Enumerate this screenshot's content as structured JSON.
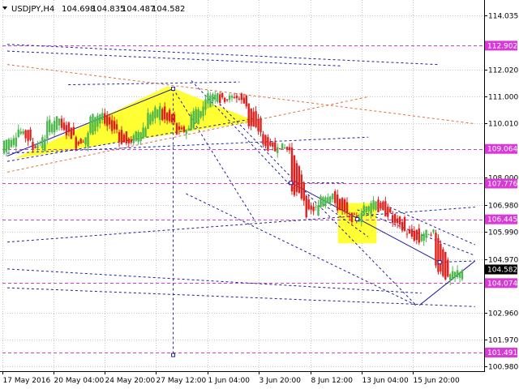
{
  "header": {
    "symbol_timeframe": "USDJPY,H4",
    "open": "104.698",
    "high": "104.835",
    "low": "104.487",
    "close": "104.582"
  },
  "colors": {
    "background": "#ffffff",
    "grid": "#c8c8c8",
    "axis": "#000000",
    "bull": "#4db84d",
    "bear": "#e0201c",
    "blue_line": "#2020a0",
    "orange_line": "#e0703a",
    "magenta_line": "#d83ad8",
    "highlight": "#ffff33",
    "current_badge": "#000000"
  },
  "chart_data": {
    "type": "candlestick",
    "instrument": "USDJPY",
    "timeframe": "H4",
    "ylim": [
      100.8,
      114.6
    ],
    "y_ticks": [
      {
        "value": 114.035,
        "label": "114.035"
      },
      {
        "value": 112.02,
        "label": "112.020"
      },
      {
        "value": 111.0,
        "label": "111.000"
      },
      {
        "value": 110.01,
        "label": "110.010"
      },
      {
        "value": 108.0,
        "label": "108.000"
      },
      {
        "value": 106.98,
        "label": "106.980"
      },
      {
        "value": 105.99,
        "label": "105.990"
      },
      {
        "value": 104.97,
        "label": "104.970"
      },
      {
        "value": 102.96,
        "label": "102.960"
      },
      {
        "value": 101.97,
        "label": "101.970"
      },
      {
        "value": 100.98,
        "label": "100.980"
      }
    ],
    "x_ticks": [
      "17 May 2016",
      "20 May 04:00",
      "24 May 20:00",
      "27 May 12:00",
      "1 Jun 04:00",
      "3 Jun 20:00",
      "8 Jun 12:00",
      "13 Jun 04:00",
      "15 Jun 20:00"
    ],
    "level_badges": [
      {
        "value": 112.902,
        "label": "112.902"
      },
      {
        "value": 109.064,
        "label": "109.064"
      },
      {
        "value": 107.776,
        "label": "107.776"
      },
      {
        "value": 106.445,
        "label": "106.445"
      },
      {
        "value": 104.074,
        "label": "104.074"
      },
      {
        "value": 101.491,
        "label": "101.491"
      }
    ],
    "current_price": {
      "value": 104.582,
      "label": "104.582"
    },
    "anchors": [
      [
        108.9,
        109.3
      ],
      [
        109.6,
        109.9
      ],
      [
        109.3,
        109.0
      ],
      [
        109.5,
        110.0
      ],
      [
        110.2,
        109.8
      ],
      [
        109.5,
        109.1
      ],
      [
        109.6,
        110.2
      ],
      [
        110.4,
        109.9
      ],
      [
        109.8,
        109.4
      ],
      [
        109.2,
        109.6
      ],
      [
        109.9,
        110.3
      ],
      [
        110.6,
        110.2
      ],
      [
        110.0,
        109.6
      ],
      [
        109.8,
        110.4
      ],
      [
        110.6,
        111.0
      ],
      [
        111.2,
        110.8
      ],
      [
        111.0,
        111.1
      ],
      [
        110.7,
        110.0
      ],
      [
        109.7,
        109.2
      ],
      [
        109.0,
        109.3
      ],
      [
        109.0,
        107.6
      ],
      [
        107.2,
        106.6
      ],
      [
        106.9,
        107.3
      ],
      [
        107.4,
        107.0
      ],
      [
        106.6,
        106.4
      ],
      [
        106.6,
        106.9
      ],
      [
        107.2,
        106.8
      ],
      [
        106.6,
        106.4
      ],
      [
        106.0,
        106.0
      ],
      [
        105.6,
        105.9
      ],
      [
        106.0,
        104.8
      ],
      [
        104.2,
        104.3
      ],
      [
        104.6,
        104.6
      ]
    ],
    "trendlines": [
      {
        "color": "blue",
        "dash": true,
        "from": [
          0.3,
          112.95
        ],
        "to": [
          40.5,
          112.2
        ]
      },
      {
        "color": "blue",
        "dash": true,
        "from": [
          0.3,
          112.7
        ],
        "to": [
          31.5,
          112.15
        ]
      },
      {
        "color": "blue",
        "dash": true,
        "from": [
          6.0,
          111.45
        ],
        "to": [
          22.0,
          111.55
        ]
      },
      {
        "color": "blue",
        "dash": false,
        "from": [
          0.3,
          108.8
        ],
        "to": [
          15.8,
          111.3
        ]
      },
      {
        "color": "blue",
        "dash": true,
        "from": [
          0.3,
          108.6
        ],
        "to": [
          23.5,
          110.2
        ]
      },
      {
        "color": "blue",
        "dash": true,
        "from": [
          0.3,
          108.9
        ],
        "to": [
          34.0,
          109.5
        ]
      },
      {
        "color": "blue",
        "dash": true,
        "from": [
          0.3,
          105.6
        ],
        "to": [
          44.0,
          106.9
        ]
      },
      {
        "color": "blue",
        "dash": true,
        "from": [
          0.3,
          104.6
        ],
        "to": [
          39.0,
          103.7
        ]
      },
      {
        "color": "blue",
        "dash": true,
        "from": [
          0.3,
          103.9
        ],
        "to": [
          44.0,
          103.2
        ]
      },
      {
        "color": "blue",
        "dash": true,
        "from": [
          15.8,
          111.3
        ],
        "to": [
          23.5,
          106.35
        ]
      },
      {
        "color": "blue",
        "dash": true,
        "from": [
          17.5,
          111.6
        ],
        "to": [
          27.0,
          107.6
        ]
      },
      {
        "color": "blue",
        "dash": true,
        "from": [
          19.5,
          111.0
        ],
        "to": [
          38.5,
          103.25
        ]
      },
      {
        "color": "blue",
        "dash": true,
        "from": [
          17.0,
          107.4
        ],
        "to": [
          38.5,
          103.25
        ]
      },
      {
        "color": "blue",
        "dash": true,
        "from": [
          26.5,
          107.8
        ],
        "to": [
          31.8,
          107.8
        ]
      },
      {
        "color": "blue",
        "dash": true,
        "from": [
          29.5,
          107.1
        ],
        "to": [
          34.0,
          105.8
        ]
      },
      {
        "color": "blue",
        "dash": false,
        "from": [
          26.8,
          107.8
        ],
        "to": [
          40.7,
          104.85
        ]
      },
      {
        "color": "blue",
        "dash": true,
        "from": [
          33.0,
          106.8
        ],
        "to": [
          44.0,
          105.1
        ]
      },
      {
        "color": "blue",
        "dash": true,
        "from": [
          36.0,
          106.9
        ],
        "to": [
          44.0,
          105.5
        ]
      },
      {
        "color": "blue",
        "dash": false,
        "from": [
          38.8,
          103.25
        ],
        "to": [
          44.0,
          104.9
        ]
      },
      {
        "color": "blue",
        "dash": true,
        "from": [
          40.7,
          104.85
        ],
        "to": [
          44.0,
          104.9
        ]
      },
      {
        "color": "blue",
        "dash": true,
        "from": [
          15.8,
          111.3
        ],
        "to": [
          15.8,
          101.4
        ]
      },
      {
        "color": "orange",
        "dash": true,
        "from": [
          0.3,
          112.2
        ],
        "to": [
          44.0,
          110.0
        ]
      },
      {
        "color": "orange",
        "dash": true,
        "from": [
          0.3,
          108.2
        ],
        "to": [
          34.0,
          111.0
        ]
      }
    ],
    "highlights": [
      {
        "shape": "triangle",
        "points": [
          [
            1.0,
            108.7
          ],
          [
            15.3,
            111.4
          ],
          [
            23.5,
            110.1
          ]
        ]
      },
      {
        "shape": "rect",
        "from": [
          31.2,
          107.05
        ],
        "to": [
          34.8,
          105.55
        ]
      }
    ],
    "markers": [
      [
        15.8,
        111.3
      ],
      [
        26.8,
        107.8
      ],
      [
        33.0,
        106.45
      ],
      [
        40.7,
        104.85
      ],
      [
        15.8,
        101.4
      ]
    ]
  }
}
